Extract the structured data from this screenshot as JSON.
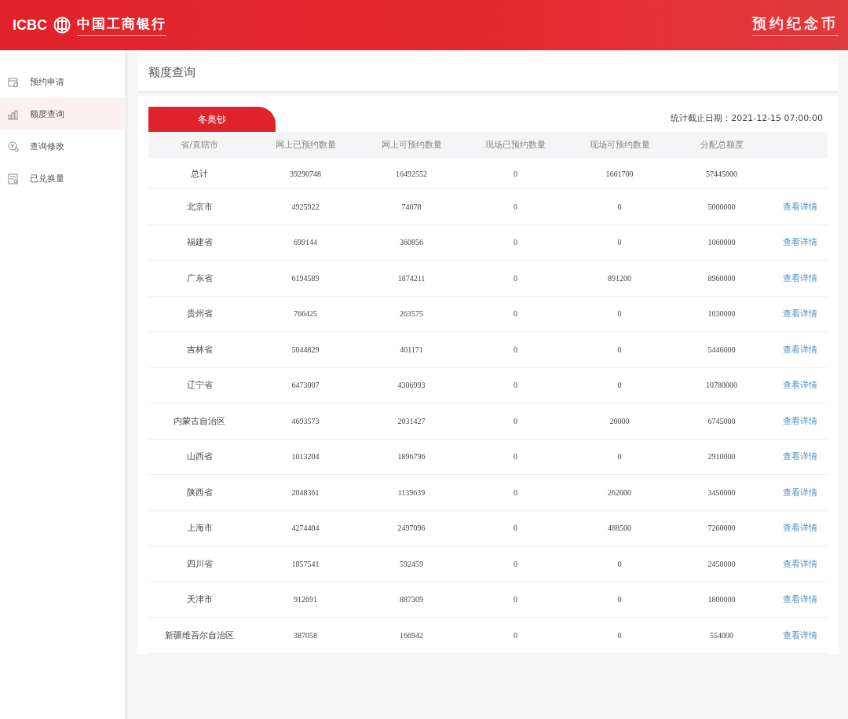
{
  "header": {
    "logo_text": "ICBC",
    "bank_name": "中国工商银行",
    "title": "预约纪念币"
  },
  "sidebar": {
    "items": [
      {
        "label": "预约申请",
        "selected": false
      },
      {
        "label": "额度查询",
        "selected": true
      },
      {
        "label": "查询修改",
        "selected": false
      },
      {
        "label": "已兑换量",
        "selected": false
      }
    ]
  },
  "page_title": "额度查询",
  "tabs": [
    {
      "label": "冬奥钞",
      "selected": true
    }
  ],
  "stat_date": "统计截止日期：2021-12-15 07:00:00",
  "table": {
    "columns": [
      "省/直辖市",
      "网上已预约数量",
      "网上可预约数量",
      "现场已预约数量",
      "现场可预约数量",
      "分配总额度"
    ],
    "rows": [
      {
        "cells": [
          "总计",
          "39290748",
          "16492552",
          "0",
          "1661700",
          "57445000"
        ]
      },
      {
        "cells": [
          "北京市",
          "4925922",
          "74078",
          "0",
          "0",
          "5000000"
        ],
        "action": "查看详情"
      },
      {
        "cells": [
          "福建省",
          "699144",
          "360856",
          "0",
          "0",
          "1060000"
        ],
        "action": "查看详情"
      },
      {
        "cells": [
          "广东省",
          "6194589",
          "1874211",
          "0",
          "891200",
          "8960000"
        ],
        "action": "查看详情"
      },
      {
        "cells": [
          "贵州省",
          "766425",
          "263575",
          "0",
          "0",
          "1030000"
        ],
        "action": "查看详情"
      },
      {
        "cells": [
          "吉林省",
          "5044829",
          "401171",
          "0",
          "0",
          "5446000"
        ],
        "action": "查看详情"
      },
      {
        "cells": [
          "辽宁省",
          "6473007",
          "4306993",
          "0",
          "0",
          "10780000"
        ],
        "action": "查看详情"
      },
      {
        "cells": [
          "内蒙古自治区",
          "4693573",
          "2031427",
          "0",
          "20000",
          "6745000"
        ],
        "action": "查看详情"
      },
      {
        "cells": [
          "山西省",
          "1013204",
          "1896796",
          "0",
          "0",
          "2910000"
        ],
        "action": "查看详情"
      },
      {
        "cells": [
          "陕西省",
          "2048361",
          "1139639",
          "0",
          "262000",
          "3450000"
        ],
        "action": "查看详情"
      },
      {
        "cells": [
          "上海市",
          "4274404",
          "2497096",
          "0",
          "488500",
          "7260000"
        ],
        "action": "查看详情"
      },
      {
        "cells": [
          "四川省",
          "1857541",
          "592459",
          "0",
          "0",
          "2450000"
        ],
        "action": "查看详情"
      },
      {
        "cells": [
          "天津市",
          "912691",
          "887309",
          "0",
          "0",
          "1800000"
        ],
        "action": "查看详情"
      },
      {
        "cells": [
          "新疆维吾尔自治区",
          "387058",
          "166942",
          "0",
          "0",
          "554000"
        ],
        "action": "查看详情"
      }
    ]
  }
}
